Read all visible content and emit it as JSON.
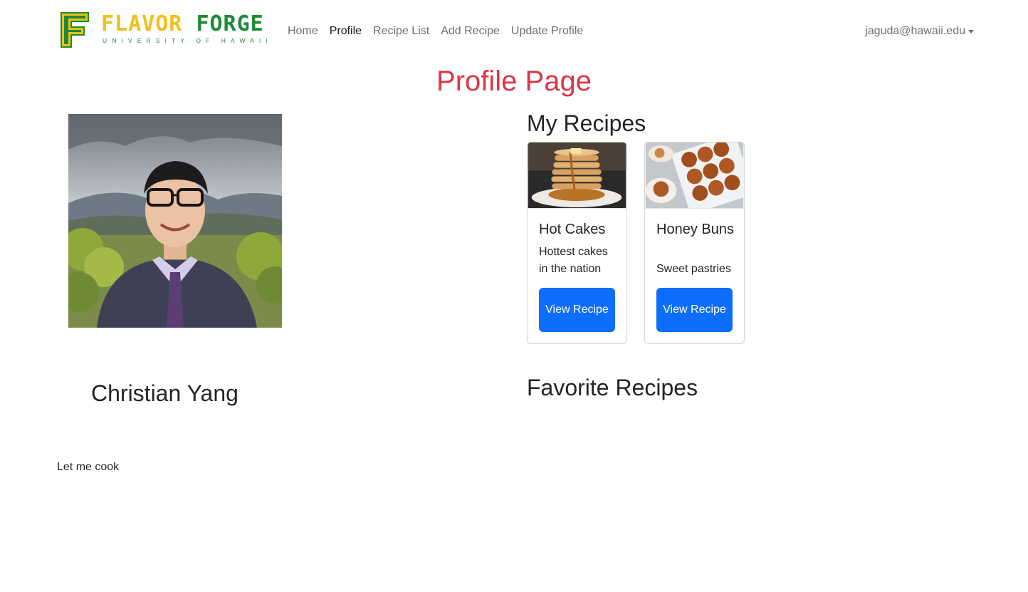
{
  "navbar": {
    "logo": {
      "word_left": "FLAVOR",
      "word_right": "FORGE",
      "tagline": "UNIVERSITY OF HAWAII"
    },
    "links": [
      {
        "label": "Home",
        "active": false
      },
      {
        "label": "Profile",
        "active": true
      },
      {
        "label": "Recipe List",
        "active": false
      },
      {
        "label": "Add Recipe",
        "active": false
      },
      {
        "label": "Update Profile",
        "active": false
      }
    ],
    "user_email": "jaguda@hawaii.edu",
    "user_menu_icon": "caret-down-icon"
  },
  "page_title": "Profile Page",
  "profile": {
    "name": "Christian Yang",
    "bio": "Let me cook",
    "avatar_alt": "profile photo"
  },
  "my_recipes": {
    "title": "My Recipes",
    "cards": [
      {
        "title": "Hot Cakes",
        "description": "Hottest cakes in the nation",
        "button_label": "View Recipe",
        "image": "pancake-stack-image"
      },
      {
        "title": "Honey Buns",
        "description": "Sweet pastries",
        "button_label": "View Recipe",
        "image": "hot-cross-buns-image"
      }
    ]
  },
  "favorite_recipes": {
    "title": "Favorite Recipes"
  },
  "colors": {
    "title_red": "#dc3545",
    "button_blue": "#0d6efd",
    "logo_yellow": "#f0c01c",
    "logo_green": "#1f8a36"
  }
}
